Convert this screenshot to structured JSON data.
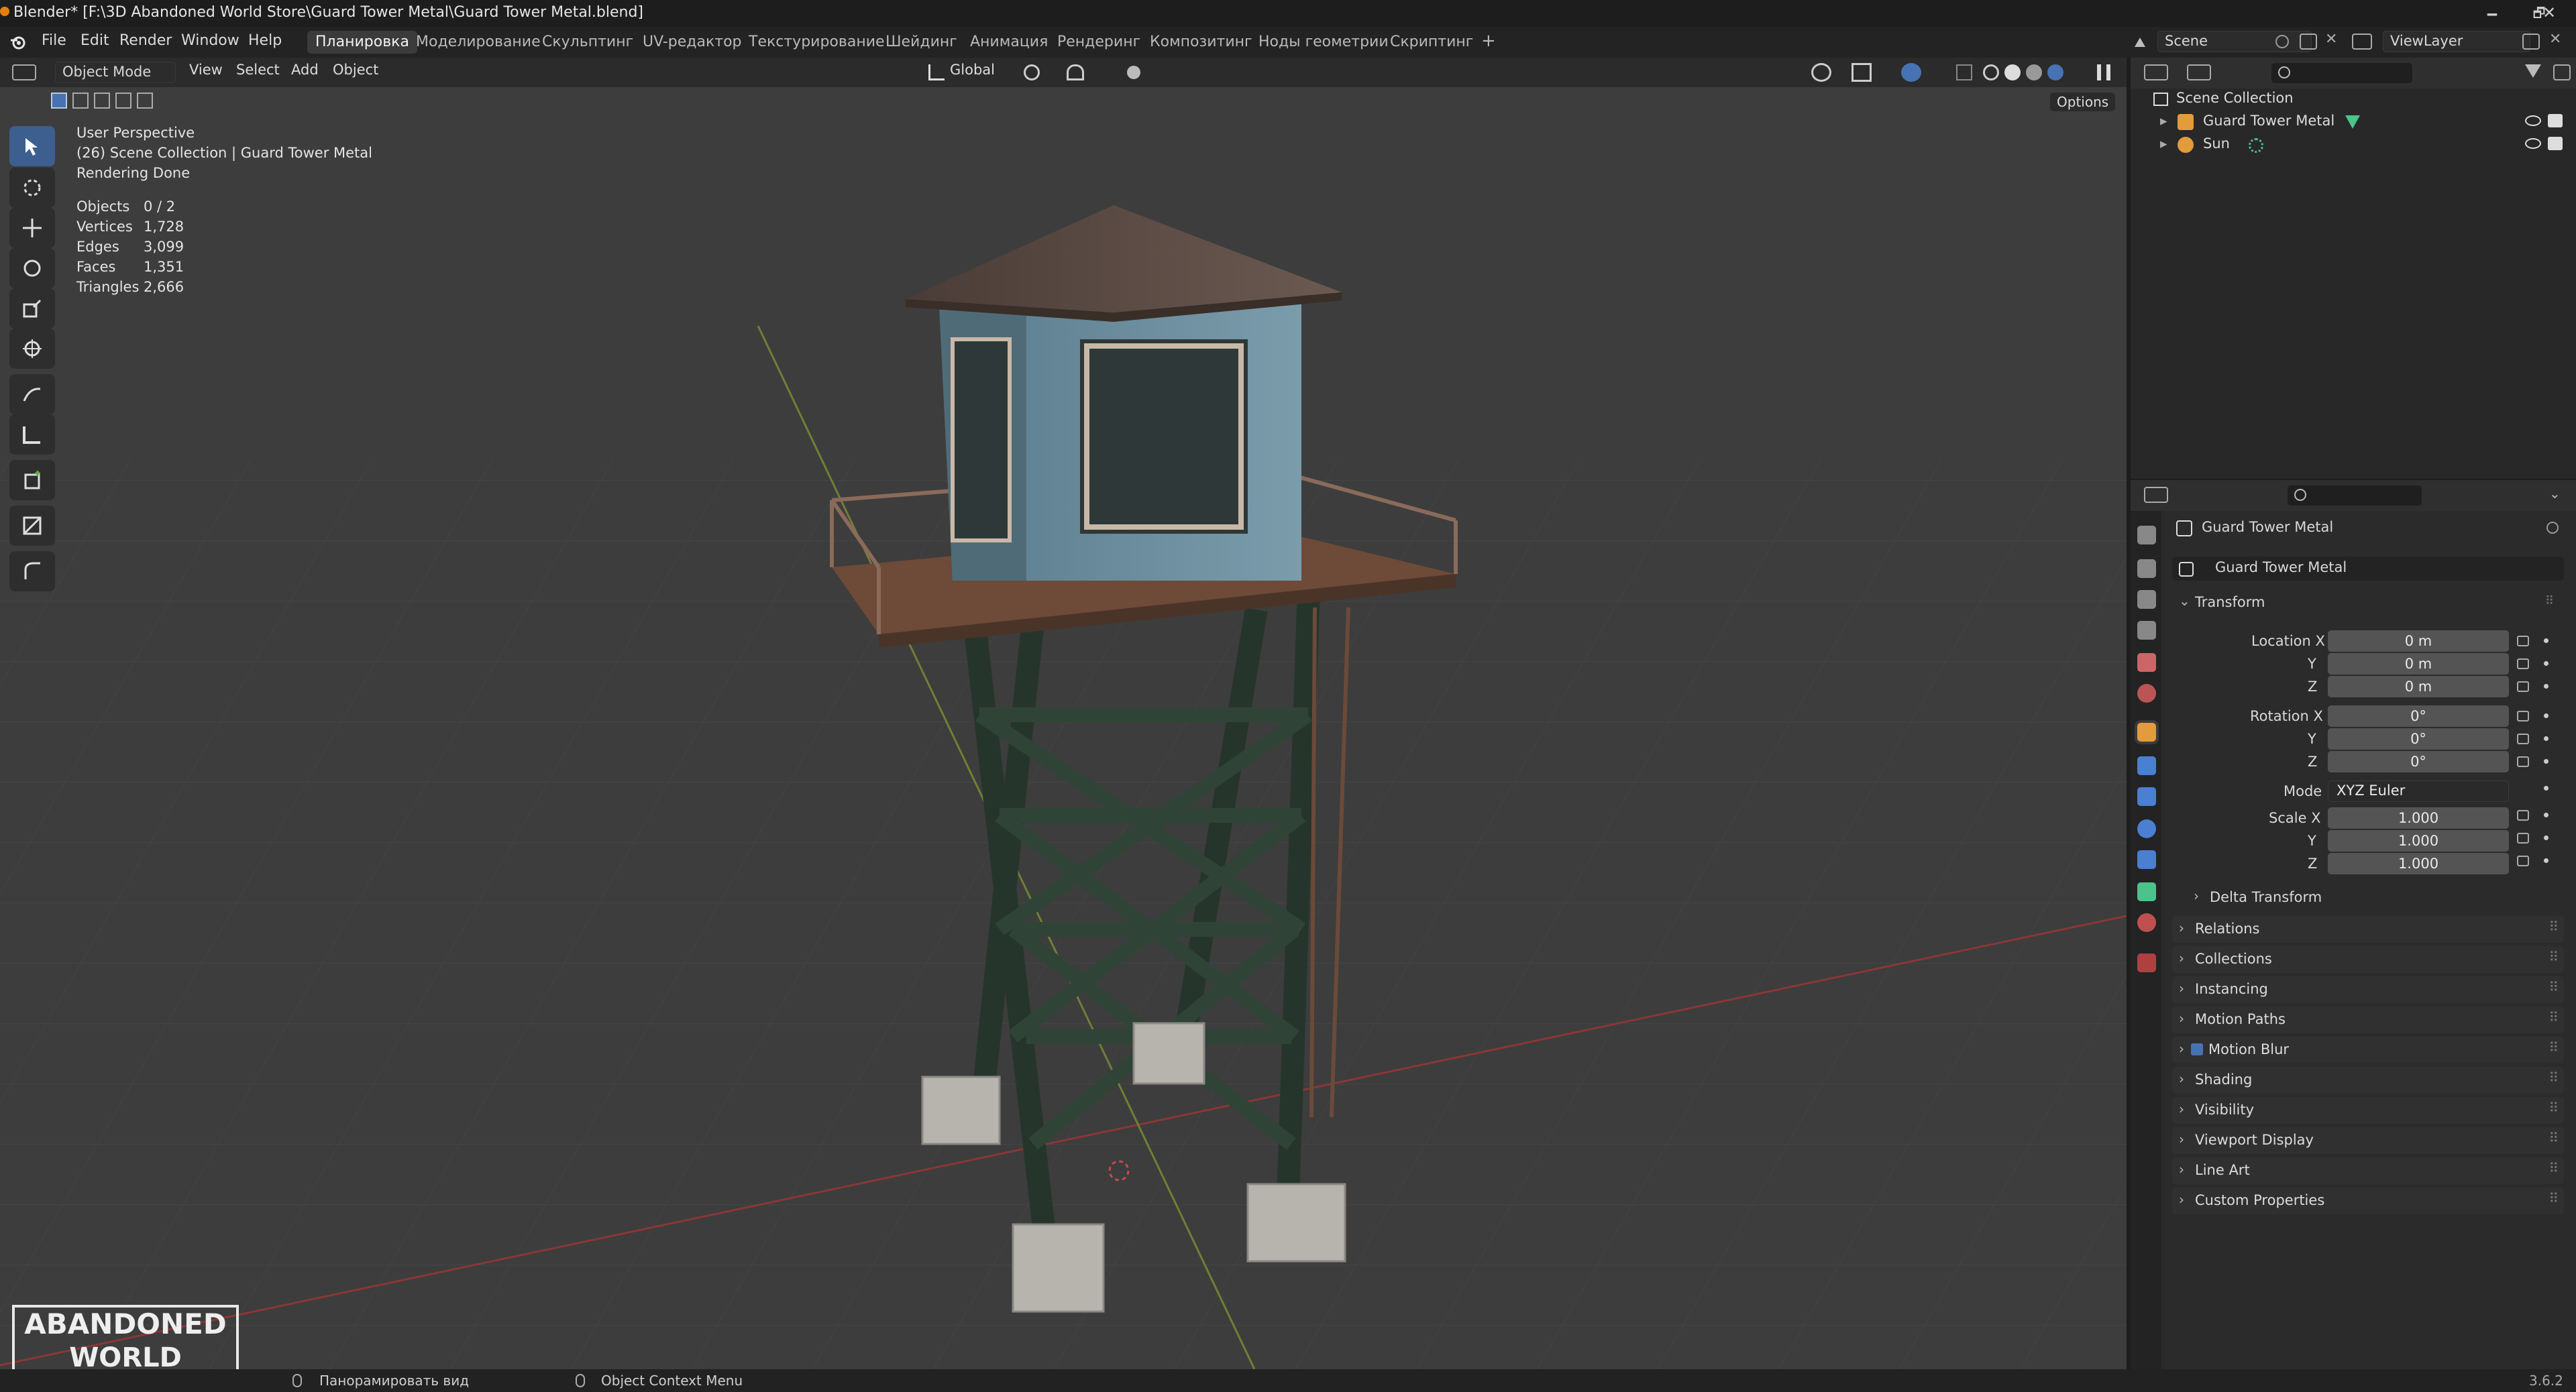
{
  "window": {
    "title": "Blender* [F:\\3D Abandoned World Store\\Guard Tower Metal\\Guard Tower Metal.blend]",
    "minimize": "🗕",
    "maximize": "🗗",
    "close": "✕"
  },
  "menus": [
    "File",
    "Edit",
    "Render",
    "Window",
    "Help"
  ],
  "workspaces": [
    "Планировка",
    "Моделирование",
    "Скульптинг",
    "UV-редактор",
    "Текстурирование",
    "Шейдинг",
    "Анимация",
    "Рендеринг",
    "Композитинг",
    "Ноды геометрии",
    "Скриптинг"
  ],
  "workspace_add": "+",
  "scene": {
    "label": "Scene",
    "viewlayer": "ViewLayer"
  },
  "viewport_header": {
    "mode": "Object Mode",
    "menu": [
      "View",
      "Select",
      "Add",
      "Object"
    ],
    "orientation": "Global",
    "options": "Options"
  },
  "overlay_text": {
    "perspective": "User Perspective",
    "collection": "(26) Scene Collection | Guard Tower Metal",
    "render_status": "Rendering Done"
  },
  "stats": [
    {
      "label": "Objects",
      "value": "0 / 2"
    },
    {
      "label": "Vertices",
      "value": "1,728"
    },
    {
      "label": "Edges",
      "value": "3,099"
    },
    {
      "label": "Faces",
      "value": "1,351"
    },
    {
      "label": "Triangles",
      "value": "2,666"
    }
  ],
  "outliner": {
    "root": "Scene Collection",
    "items": [
      {
        "name": "Guard Tower Metal",
        "icon": "mesh-icon"
      },
      {
        "name": "Sun",
        "icon": "light-icon"
      }
    ]
  },
  "properties": {
    "object_name": "Guard Tower Metal",
    "datablock": "Guard Tower Metal",
    "transform_header": "Transform",
    "location": {
      "label": "Location X",
      "y": "Y",
      "z": "Z",
      "values": [
        "0 m",
        "0 m",
        "0 m"
      ]
    },
    "rotation": {
      "label": "Rotation X",
      "y": "Y",
      "z": "Z",
      "values": [
        "0°",
        "0°",
        "0°"
      ]
    },
    "mode": {
      "label": "Mode",
      "value": "XYZ Euler"
    },
    "scale": {
      "label": "Scale X",
      "y": "Y",
      "z": "Z",
      "values": [
        "1.000",
        "1.000",
        "1.000"
      ]
    },
    "delta": "Delta Transform",
    "panels": [
      "Relations",
      "Collections",
      "Instancing",
      "Motion Paths",
      "Motion Blur",
      "Shading",
      "Visibility",
      "Viewport Display",
      "Line Art",
      "Custom Properties"
    ]
  },
  "statusbar": {
    "pan": "Панорамировать вид",
    "context": "Object Context Menu",
    "version": "3.6.2"
  },
  "logo": {
    "line1": "ABANDONED",
    "line2": "WORLD"
  },
  "colors": {
    "accent": "#4772b3",
    "background": "#3d3d3d",
    "x_axis": "#9b3a3a",
    "y_axis": "#7a8b3a"
  }
}
